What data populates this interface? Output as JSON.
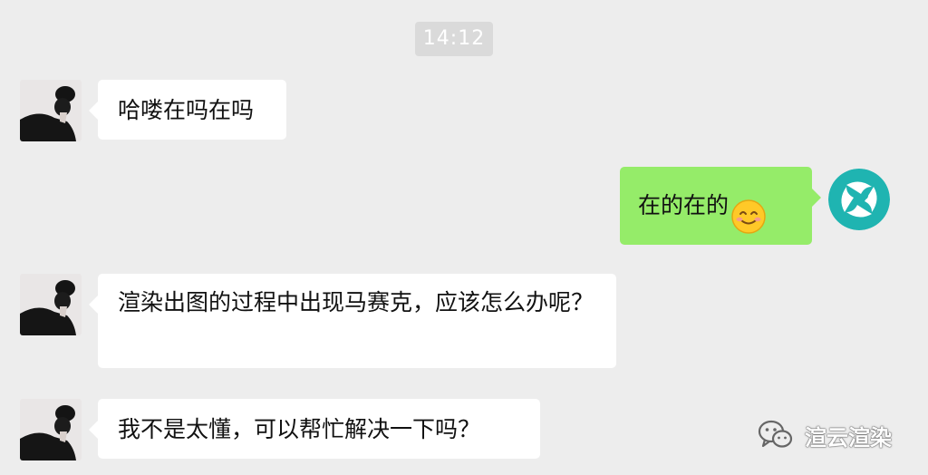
{
  "timestamp": "14:12",
  "messages": [
    {
      "side": "left",
      "text": "哈喽在吗在吗"
    },
    {
      "side": "right",
      "text": "在的在的",
      "emoji": "smiling-face-emoji"
    },
    {
      "side": "left",
      "text": "渲染出图的过程中出现马赛克，应该怎么办呢？"
    },
    {
      "side": "left",
      "text": "我不是太懂，可以帮忙解决一下吗？"
    }
  ],
  "watermark": {
    "text": "渲云渲染",
    "icon": "wechat-icon"
  },
  "colors": {
    "background": "#ededed",
    "incoming_bubble": "#ffffff",
    "outgoing_bubble": "#95ec69",
    "service_avatar": "#1fb4b1"
  }
}
